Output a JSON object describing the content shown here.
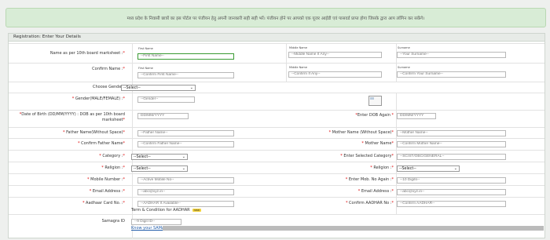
{
  "notice": "मध्य प्रदेश के निवासी छात्रों का इस पोर्टल पर पंजीयन हेतु अपनी जानकारी सही सही भरें। पंजीयन होने पर आपको एक यूजर आईडी एवं पासवर्ड प्राप्त होगा जिसके द्वारा आप लॉगिन कर सकेंगे।",
  "panel_title": "Registration: Enter Your Details",
  "name_row": {
    "label": "Name as per 10th board marksheet :",
    "first_caption": "First Name",
    "first_placeholder": "--First Name--",
    "middle_caption": "Middle Name",
    "middle_placeholder": "--Middle Name If Any--",
    "last_caption": "Surname",
    "last_placeholder": "--Your Surname--"
  },
  "confirm_name_row": {
    "label": "Confirm Name :",
    "first_caption": "First Name",
    "first_placeholder": "--Confirm First Name--",
    "middle_caption": "Middle Name",
    "middle_placeholder": "--Confirm If Any--",
    "last_caption": "Surname",
    "last_placeholder": "--Confirm Your Surname--"
  },
  "choose_gender": {
    "label": "Choose Gender",
    "value": "--Select--"
  },
  "gender_text": {
    "label": "Gender(MALE/FEMALE) :",
    "placeholder": "--Gender--"
  },
  "dob": {
    "label": "Date of Birth (DD/MM/YYYY) : DOB as per 10th board marksheet",
    "placeholder": "DD/MM/YYYY",
    "again_label": "Enter DOB Again",
    "again_placeholder": "DD/MM/YYYY"
  },
  "father_name": {
    "label": "Father Name(Without Space)",
    "placeholder": "--Father Name--"
  },
  "mother_name": {
    "label": "Mother Name (Without Space)",
    "placeholder": "--Mother Name--"
  },
  "confirm_father": {
    "label": "Confirm Father Name",
    "placeholder": "--Confirm Father Name--"
  },
  "confirm_mother": {
    "label": "Mother Name",
    "placeholder": "--Confirm Mother Name--"
  },
  "category": {
    "label": "Category :",
    "value": "--Select--"
  },
  "selected_category": {
    "label": "Enter Selected Category",
    "placeholder": "--SC/ST/OBC/GENERAL--"
  },
  "religion": {
    "label": "Religion :",
    "value": "--Select--"
  },
  "religion2": {
    "label": "Religion :",
    "value": "--Select--"
  },
  "mobile": {
    "label": "Mobile Number :",
    "placeholder": "--Active Mobile No--"
  },
  "mobile_again": {
    "label": "Enter Mob. No Again :",
    "placeholder": "--10 Digits--"
  },
  "email": {
    "label": "Email Address :",
    "placeholder": "--abc@xyz.in--"
  },
  "email2": {
    "label": "Email Address :",
    "placeholder": "--abc@xyz.in--"
  },
  "aadhar": {
    "label": "Aadhaar Card No. :",
    "placeholder": "--AADHAR If Available--",
    "terms": "Term & Condition for AADHAR",
    "badge": "new"
  },
  "confirm_aadhar": {
    "label": "Confirm AADHAR No :",
    "placeholder": "--Confirm AADHAR--"
  },
  "samagra": {
    "label": "Samagra ID",
    "placeholder": "--9 Digit ID--",
    "link": "Know your SAMAGRA ID"
  },
  "colors": {
    "required": "#dd0000",
    "focus_border": "#3a9b34",
    "notice_bg": "#d8ecd6",
    "link": "#1e5aa8"
  }
}
